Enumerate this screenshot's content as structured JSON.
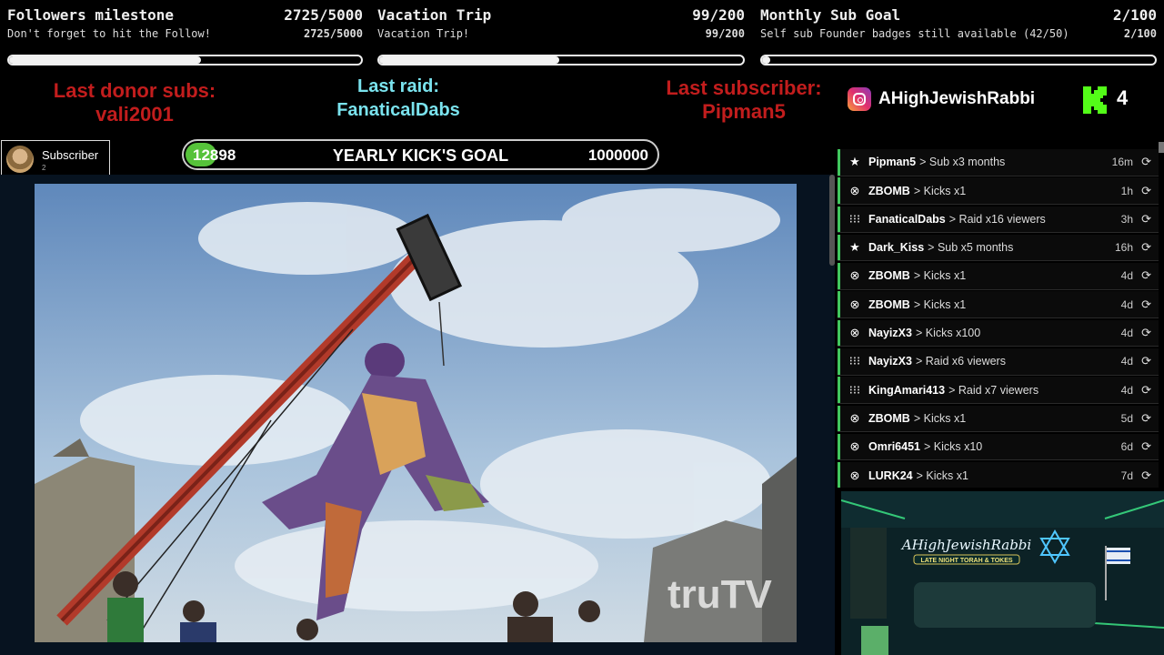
{
  "goals": [
    {
      "title": "Followers milestone",
      "count": "2725/5000",
      "subtitle": "Don't forget to hit the Follow!",
      "count_small": "2725/5000",
      "progress": 0.545
    },
    {
      "title": "Vacation Trip",
      "count": "99/200",
      "subtitle": "Vacation Trip!",
      "count_small": "99/200",
      "progress": 0.495
    },
    {
      "title": "Monthly Sub Goal",
      "count": "2/100",
      "subtitle": "Self sub Founder badges still available (42/50)",
      "count_small": "2/100",
      "progress": 0.02
    }
  ],
  "last": {
    "donor_label": "Last donor subs:",
    "donor_name": "vali2001",
    "raid_label": "Last raid:",
    "raid_name": "FanaticalDabs",
    "sub_label": "Last subscriber:",
    "sub_name": "Pipman5"
  },
  "social": {
    "instagram": "AHighJewishRabbi",
    "kick_count": "4"
  },
  "subscriber_badge": {
    "label": "Subscriber",
    "number": "2"
  },
  "kicks_goal": {
    "current": "12898",
    "title": "YEARLY KICK'S GOAL",
    "target": "1000000",
    "progress": 0.0129
  },
  "events": [
    {
      "icon": "star",
      "user": "Pipman5",
      "action": "Sub x3 months",
      "time": "16m"
    },
    {
      "icon": "kick",
      "user": "ZBOMB",
      "action": "Kicks x1",
      "time": "1h"
    },
    {
      "icon": "raid",
      "user": "FanaticalDabs",
      "action": "Raid x16 viewers",
      "time": "3h"
    },
    {
      "icon": "star",
      "user": "Dark_Kiss",
      "action": "Sub x5 months",
      "time": "16h"
    },
    {
      "icon": "kick",
      "user": "ZBOMB",
      "action": "Kicks x1",
      "time": "4d"
    },
    {
      "icon": "kick",
      "user": "ZBOMB",
      "action": "Kicks x1",
      "time": "4d"
    },
    {
      "icon": "kick",
      "user": "NayizX3",
      "action": "Kicks x100",
      "time": "4d"
    },
    {
      "icon": "raid",
      "user": "NayizX3",
      "action": "Raid x6 viewers",
      "time": "4d"
    },
    {
      "icon": "raid",
      "user": "KingAmari413",
      "action": "Raid x7 viewers",
      "time": "4d"
    },
    {
      "icon": "kick",
      "user": "ZBOMB",
      "action": "Kicks x1",
      "time": "5d"
    },
    {
      "icon": "kick",
      "user": "Omri6451",
      "action": "Kicks x10",
      "time": "6d"
    },
    {
      "icon": "kick",
      "user": "LURK24",
      "action": "Kicks x1",
      "time": "7d"
    }
  ],
  "brand": {
    "name": "AHighJewishRabbi",
    "tagline": "LATE NIGHT TORAH & TOKES"
  },
  "watermark": "truTV",
  "colors": {
    "accent_green": "#41c75e",
    "label_red": "#c21d1d",
    "label_cyan": "#7ae3ee",
    "kick_green": "#53fc18"
  }
}
